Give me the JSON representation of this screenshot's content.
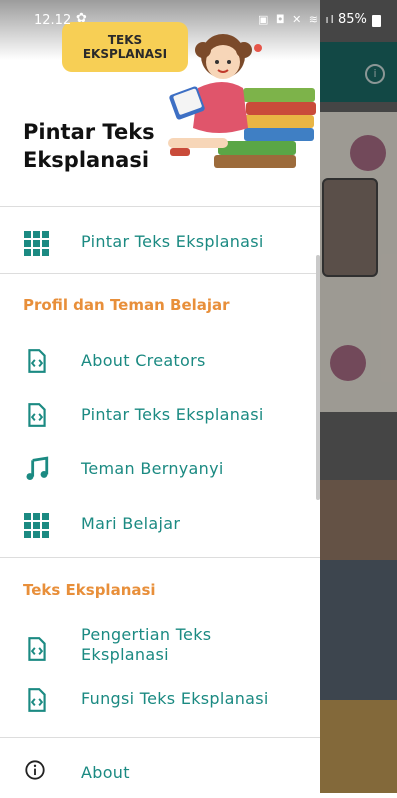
{
  "status_bar": {
    "time": "12.12",
    "battery": "85%"
  },
  "header": {
    "badge_line1": "TEKS",
    "badge_line2": "EKSPLANASI",
    "title": "Pintar Teks Eksplanasi"
  },
  "menu": {
    "top_item": {
      "label": "Pintar Teks Eksplanasi",
      "icon": "grid-icon"
    },
    "section1": {
      "title": "Profil dan Teman Belajar",
      "items": [
        {
          "label": "About Creators",
          "icon": "code-file-icon"
        },
        {
          "label": "Pintar Teks Eksplanasi",
          "icon": "code-file-icon"
        },
        {
          "label": "Teman Bernyanyi",
          "icon": "music-note-icon"
        },
        {
          "label": "Mari Belajar",
          "icon": "grid-icon"
        }
      ]
    },
    "section2": {
      "title": "Teks Eksplanasi",
      "items": [
        {
          "label": "Pengertian Teks Eksplanasi",
          "icon": "code-file-icon"
        },
        {
          "label": "Fungsi Teks Eksplanasi",
          "icon": "code-file-icon"
        }
      ]
    },
    "about": {
      "label": "About",
      "icon": "info-icon"
    }
  },
  "colors": {
    "accent": "#1b8a82",
    "section": "#e88f3a",
    "toolbar": "#1d6f6a"
  }
}
